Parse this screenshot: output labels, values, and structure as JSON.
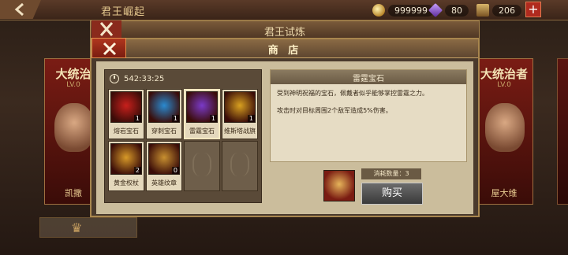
{
  "top_bar": {
    "title": "君王崛起",
    "resources": [
      {
        "name": "gold",
        "icon": "gold-coin-icon",
        "value": "999999"
      },
      {
        "name": "gem",
        "icon": "purple-gem-icon",
        "value": "80"
      },
      {
        "name": "chest",
        "icon": "treasure-chest-icon",
        "value": "206"
      }
    ],
    "plus_label": "+"
  },
  "background_cards": {
    "left": {
      "title": "大统治",
      "subtitle": "LV.0",
      "name": "凯撒"
    },
    "right": {
      "title": "大统治者",
      "subtitle": "LV.0",
      "name": "屋大维"
    }
  },
  "panel_back": {
    "title": "君王试炼"
  },
  "shop": {
    "title": "商 店",
    "timer": "542:33:25",
    "items": [
      {
        "name": "熔岩宝石",
        "qty": "1",
        "icon": "lava-gem-icon",
        "color": "#c8201c",
        "selected": false
      },
      {
        "name": "穿刺宝石",
        "qty": "1",
        "icon": "pierce-gem-icon",
        "color": "#2a8ad0",
        "selected": false
      },
      {
        "name": "雷霆宝石",
        "qty": "1",
        "icon": "thunder-gem-icon",
        "color": "#7a3ac8",
        "selected": true
      },
      {
        "name": "维斯塔战旗",
        "qty": "1",
        "icon": "vesta-banner-icon",
        "color": "#d8a020",
        "selected": false
      },
      {
        "name": "黄金权杖",
        "qty": "2",
        "icon": "golden-scepter-icon",
        "color": "#d89a28",
        "selected": false
      },
      {
        "name": "英雄纹章",
        "qty": "0",
        "icon": "hero-emblem-icon",
        "color": "#c89030",
        "selected": false
      }
    ],
    "empty_slots": 2,
    "detail": {
      "name": "雷霆宝石",
      "description": "受到神明祝福的宝石，佩戴者似乎能够掌控雷霆之力。",
      "effect": "攻击时对目标周围2个敌军造成5%伤害。"
    },
    "cost": {
      "label": "消耗数量：3",
      "icon": "hero-emblem-icon"
    },
    "buy_label": "购买"
  }
}
